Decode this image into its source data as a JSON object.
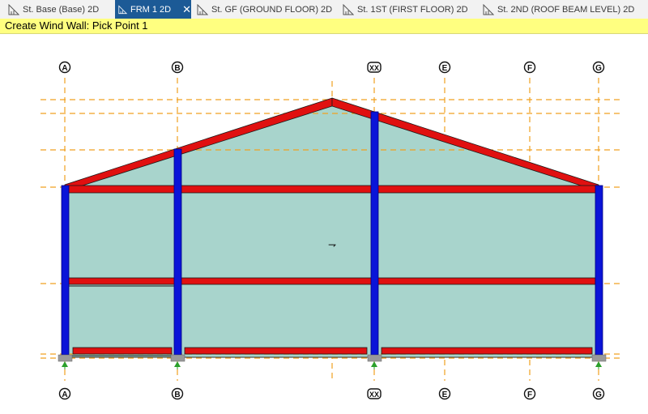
{
  "tabs": [
    {
      "label": "St. Base (Base) 2D",
      "icon": "structure-view-icon",
      "active": false
    },
    {
      "label": "FRM 1 2D",
      "icon": "structure-view-icon",
      "active": true,
      "close": "✕"
    },
    {
      "label": "St. GF (GROUND FLOOR) 2D",
      "icon": "structure-view-icon",
      "active": false
    },
    {
      "label": "St. 1ST (FIRST FLOOR) 2D",
      "icon": "structure-view-icon",
      "active": false
    },
    {
      "label": "St. 2ND (ROOF BEAM LEVEL) 2D",
      "icon": "structure-view-icon",
      "active": false
    }
  ],
  "status": {
    "prompt": "Create Wind Wall: Pick Point 1",
    "color": "#ffff80"
  },
  "grid": {
    "labels": [
      "A",
      "B",
      "XX",
      "E",
      "F",
      "G"
    ],
    "line_color": "#f0a020"
  },
  "colors": {
    "column": "#0a14d8",
    "beam": "#e01010",
    "wall_fill": "#a8d4cc",
    "support": "#9a9a9a",
    "support_arrow": "#2aa02a"
  },
  "marker": "⇁"
}
